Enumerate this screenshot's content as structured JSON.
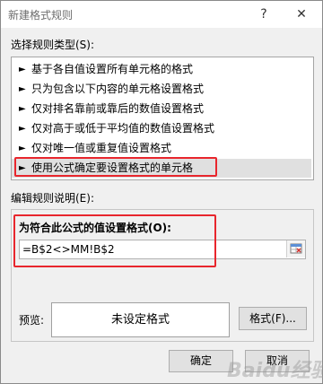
{
  "dialog": {
    "title": "新建格式规则",
    "help_glyph": "?",
    "close_glyph": "✕"
  },
  "rule_type": {
    "label": "选择规则类型(S):",
    "items": [
      {
        "arrow": "►",
        "label": "基于各自值设置所有单元格的格式"
      },
      {
        "arrow": "►",
        "label": "只为包含以下内容的单元格设置格式"
      },
      {
        "arrow": "►",
        "label": "仅对排名靠前或靠后的数值设置格式"
      },
      {
        "arrow": "►",
        "label": "仅对高于或低于平均值的数值设置格式"
      },
      {
        "arrow": "►",
        "label": "仅对唯一值或重复值设置格式"
      },
      {
        "arrow": "►",
        "label": "使用公式确定要设置格式的单元格",
        "selected": true
      }
    ]
  },
  "edit_rule": {
    "label": "编辑规则说明(E):",
    "formula_label": "为符合此公式的值设置格式(O):",
    "formula_value": "=B$2<>MM!B$2",
    "preview_label": "预览:",
    "preview_text": "未设定格式",
    "format_button": "格式(F)..."
  },
  "footer": {
    "ok": "确定",
    "cancel": "取消"
  },
  "colors": {
    "highlight": "#e8262d",
    "selected_row": "#e0e0e0"
  },
  "watermark": "Baidu经验"
}
